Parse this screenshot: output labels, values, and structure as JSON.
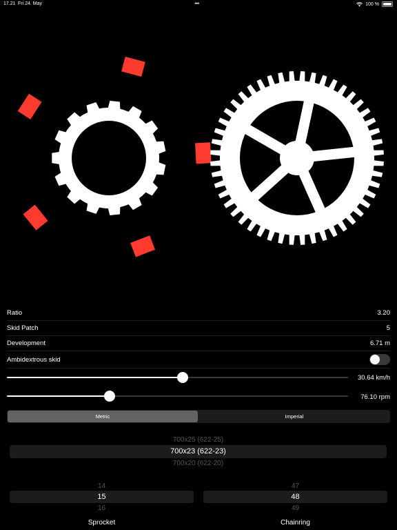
{
  "status": {
    "time": "17.21",
    "date": "Fri 24. May",
    "dots": "•••",
    "battery": "100 %"
  },
  "colors": {
    "background": "#000000",
    "gear": "#ffffff",
    "skid_marker": "#ff3b30",
    "row_divider": "#1e1e1e"
  },
  "illustration": {
    "sprocket_teeth": 15,
    "chainring_teeth": 48,
    "skid_patches": 5
  },
  "stats": {
    "ratio_label": "Ratio",
    "ratio_value": "3.20",
    "skid_label": "Skid Patch",
    "skid_value": "5",
    "development_label": "Development",
    "development_value": "6.71 m"
  },
  "ambidextrous": {
    "label": "Ambidextrous skid",
    "enabled": false
  },
  "speed_slider": {
    "value_text": "30.64 km/h",
    "fraction": 0.515
  },
  "cadence_slider": {
    "value_text": "76.10 rpm",
    "fraction": 0.3
  },
  "units": {
    "options": [
      "Metric",
      "Imperial"
    ],
    "selected": "Metric"
  },
  "tire_picker": {
    "above": "700x25 (622-25)",
    "selected": "700x23 (622-23)",
    "below": "700x20 (622-20)"
  },
  "sprocket_picker": {
    "above": "14",
    "selected": "15",
    "below": "16",
    "label": "Sprocket"
  },
  "chainring_picker": {
    "above": "47",
    "selected": "48",
    "below": "49",
    "label": "Chainring"
  }
}
